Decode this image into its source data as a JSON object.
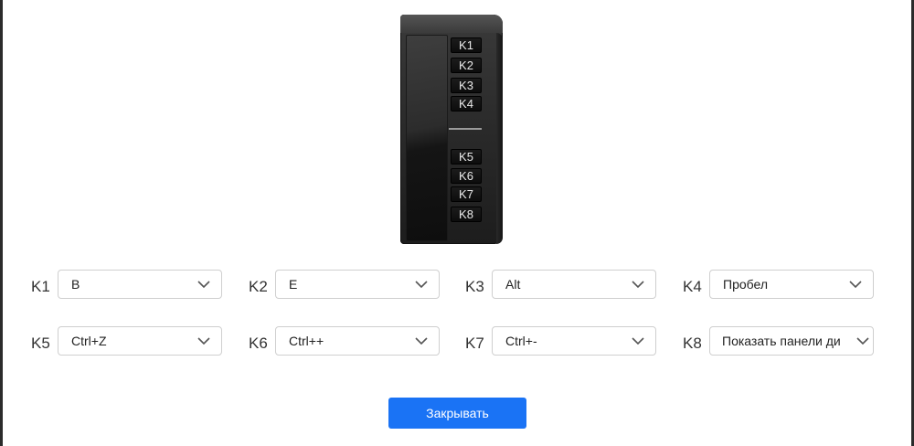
{
  "tablet_keys": [
    "K1",
    "K2",
    "K3",
    "K4",
    "K5",
    "K6",
    "K7",
    "K8"
  ],
  "rows": [
    [
      {
        "label": "K1",
        "value": "B"
      },
      {
        "label": "K2",
        "value": "E"
      },
      {
        "label": "K3",
        "value": "Alt"
      },
      {
        "label": "K4",
        "value": "Пробел"
      }
    ],
    [
      {
        "label": "K5",
        "value": "Ctrl+Z"
      },
      {
        "label": "K6",
        "value": "Ctrl++"
      },
      {
        "label": "K7",
        "value": "Ctrl+-"
      },
      {
        "label": "K8",
        "value": "Показать панели ди"
      }
    ]
  ],
  "close_button": {
    "label": "Закрывать"
  },
  "colors": {
    "accent": "#1a73f5"
  },
  "icons": {
    "dropdown": "chevron-down-icon"
  }
}
